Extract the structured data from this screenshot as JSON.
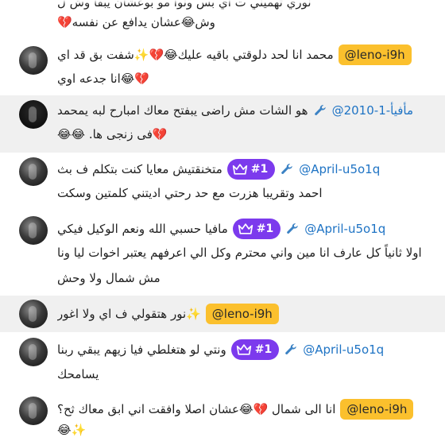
{
  "messages": [
    {
      "user": "",
      "line1": "نوري تهميني ت اي بس ونوا مو بوعشان يبقا وش ل",
      "line2": "وش😂عشان يدافع عن نفسه💔"
    },
    {
      "user": "@leno-i9h",
      "line1": "محمد انا لحد دلوقتي باقيه عليك😂💔✨شفت بق قد اي",
      "line2": "💔😂انا جدعه اوي"
    },
    {
      "user": "@مأفيأ-1-2010",
      "line1": "هو الشات مش راضى يبفتح معاك امبارح لبه يمحمد",
      "line2": "💔فى زنجى ها. 😂😂"
    },
    {
      "user": "@April-u5o1q",
      "rank": "#1",
      "line1": "متخنقتيش معايا كنت بتكلم ف بث",
      "line2": "احمد وتقريبا هزرت مع حد رحتي اديتني كلمتين وسكت"
    },
    {
      "user": "@April-u5o1q",
      "rank": "#1",
      "line1": "مافيا حسبي الله ونعم الوكيل فيكي",
      "line2": "اولا ثانياً كل عارف انا مين واني محترم وكل الي اعرفهم يعتبر اخوات ليا ونا",
      "line3": "مش شمال ولا وحش"
    },
    {
      "user": "@leno-i9h",
      "line1": "✨نور هتقولي ف اي ولا اغور"
    },
    {
      "user": "@April-u5o1q",
      "rank": "#1",
      "line1": "ونتي لو هتغلطي فيا زيهم يبقي ربنا",
      "line2": "يسامحك"
    },
    {
      "user": "@leno-i9h",
      "line1": "انا الى شمال 💔😂عشان اصلا وافقت اني ابق معاك ثح؟",
      "line2": "✨😂"
    }
  ],
  "colors": {
    "chip_yellow": "#fbc02d",
    "rank_purple": "#7c3aed",
    "link_blue": "#1e73c4",
    "wrench_blue": "#3b82c4",
    "alt_row": "#f0f0f0"
  },
  "icons": {
    "wrench": "wrench-icon",
    "crown": "crown-icon",
    "avatar": "avatar"
  }
}
